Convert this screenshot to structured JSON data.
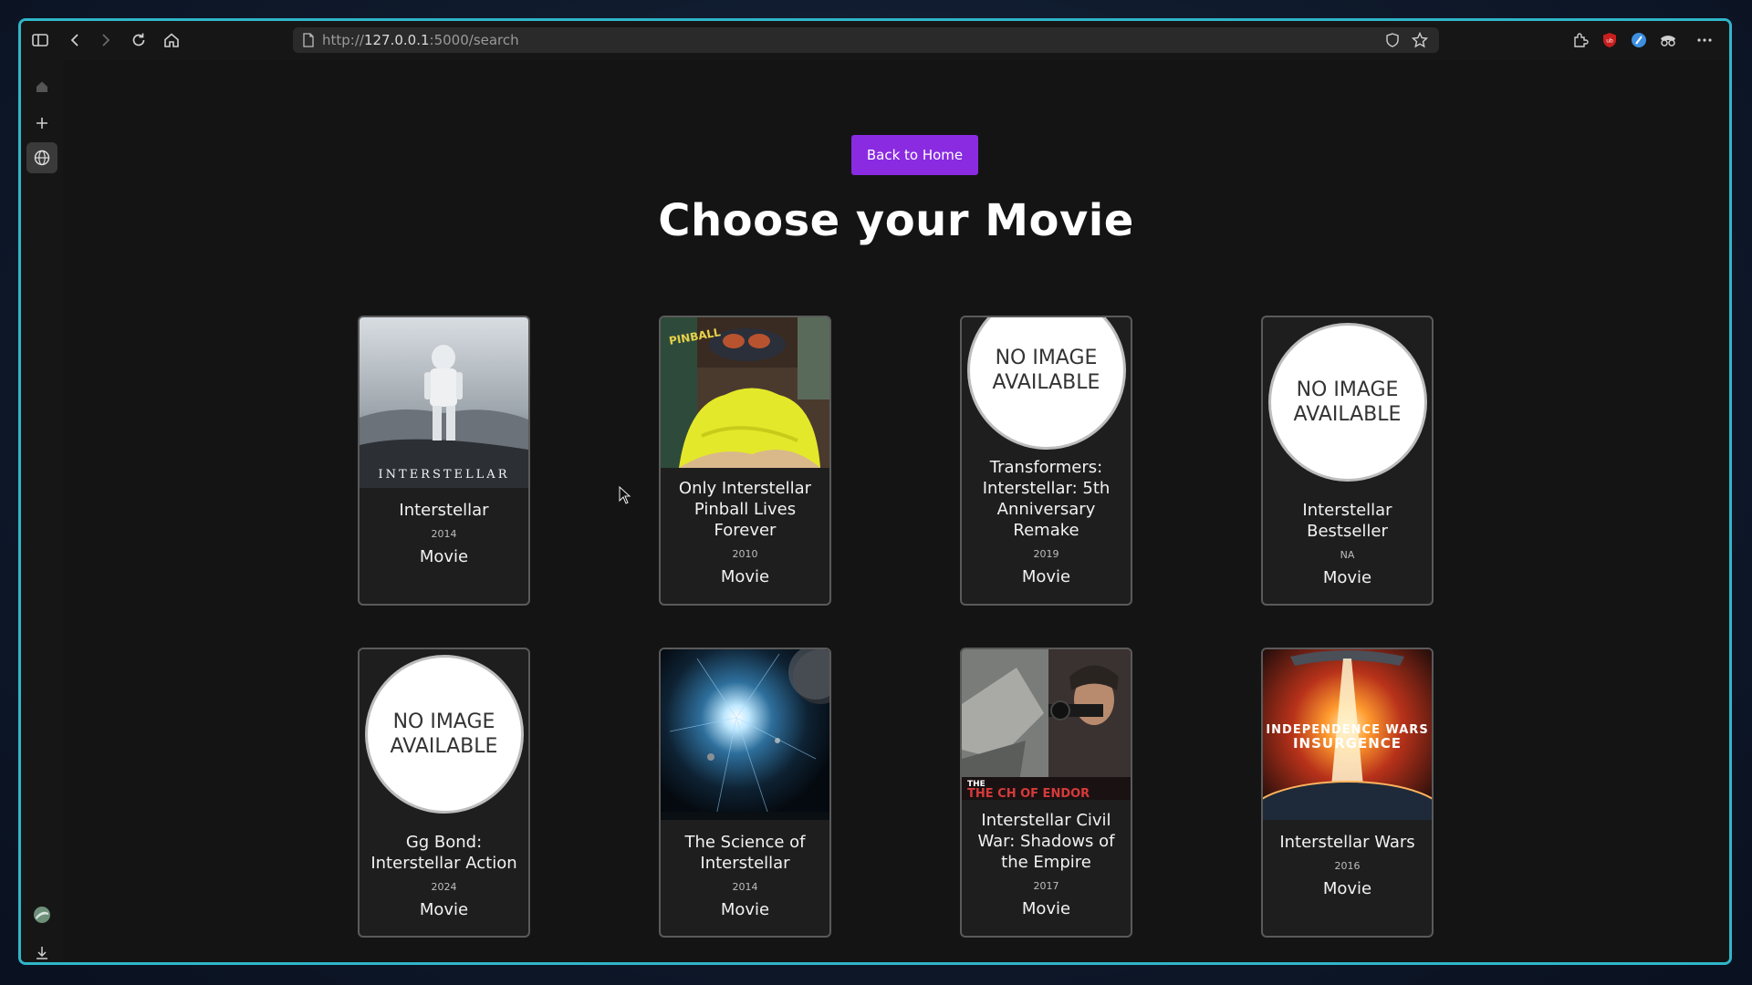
{
  "browser": {
    "url_prefix": "http://",
    "url_host": "127.0.0.1",
    "url_rest": ":5000/search"
  },
  "page": {
    "back_button": "Back to Home",
    "heading": "Choose your Movie",
    "no_image_text": "NO IMAGE AVAILABLE"
  },
  "movies": [
    {
      "title": "Interstellar",
      "year": "2014",
      "type": "Movie",
      "poster": "astronaut"
    },
    {
      "title": "Only Interstellar Pinball Lives Forever",
      "year": "2010",
      "type": "Movie",
      "poster": "pinball"
    },
    {
      "title": "Transformers: Interstellar: 5th Anniversary Remake",
      "year": "2019",
      "type": "Movie",
      "poster": "none"
    },
    {
      "title": "Interstellar Bestseller",
      "year": "NA",
      "type": "Movie",
      "poster": "none"
    },
    {
      "title": "Gg Bond: Interstellar Action",
      "year": "2024",
      "type": "Movie",
      "poster": "none"
    },
    {
      "title": "The Science of Interstellar",
      "year": "2014",
      "type": "Movie",
      "poster": "space"
    },
    {
      "title": "Interstellar Civil War: Shadows of the Empire",
      "year": "2017",
      "type": "Movie",
      "poster": "soldier"
    },
    {
      "title": "Interstellar Wars",
      "year": "2016",
      "type": "Movie",
      "poster": "explosion"
    }
  ],
  "poster_texts": {
    "interstellar_logo": "INTERSTELLAR",
    "pinball_logo": "PINBALL",
    "endor_logo": "THE CH OF ENDOR",
    "wars_logo_1": "INDEPENDENCE WARS",
    "wars_logo_2": "INSURGENCE"
  },
  "colors": {
    "accent": "#8a2be2",
    "window_border": "#2fb6c9"
  }
}
